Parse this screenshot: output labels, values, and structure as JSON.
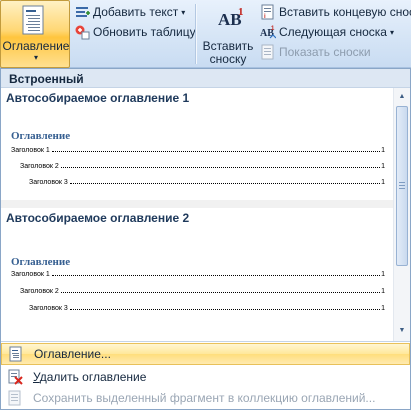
{
  "ribbon": {
    "toc_button": {
      "label": "Оглавление",
      "arrow": "▾"
    },
    "add_text": {
      "label": "Добавить текст",
      "arrow": "▾"
    },
    "update_table": {
      "label": "Обновить таблицу"
    },
    "insert_footnote": {
      "icon_text": "AB",
      "superscript": "1",
      "label_line1": "Вставить",
      "label_line2": "сноску"
    },
    "insert_endnote": {
      "label": "Вставить концевую сноск"
    },
    "next_footnote": {
      "label": "Следующая сноска",
      "arrow": "▾"
    },
    "show_notes": {
      "label": "Показать сноски"
    }
  },
  "panel": {
    "group_header": "Встроенный",
    "items": [
      {
        "title": "Автособираемое оглавление 1",
        "heading": "Оглавление",
        "entries": [
          {
            "text": "Заголовок 1",
            "page": "1"
          },
          {
            "text": "Заголовок 2",
            "page": "1"
          },
          {
            "text": "Заголовок 3",
            "page": "1"
          }
        ]
      },
      {
        "title": "Автособираемое оглавление 2",
        "heading": "Оглавление",
        "entries": [
          {
            "text": "Заголовок 1",
            "page": "1"
          },
          {
            "text": "Заголовок 2",
            "page": "1"
          },
          {
            "text": "Заголовок 3",
            "page": "1"
          }
        ]
      }
    ],
    "menu": {
      "toc_dialog": "Оглавление...",
      "remove_toc_underlined": "У",
      "remove_toc_rest": "далить оглавление",
      "save_selection": "Сохранить выделенный фрагмент в коллекцию оглавлений..."
    }
  },
  "colors": {
    "accent": "#ffd774",
    "ribbon": "#d6e5f6",
    "heading": "#365f91"
  }
}
